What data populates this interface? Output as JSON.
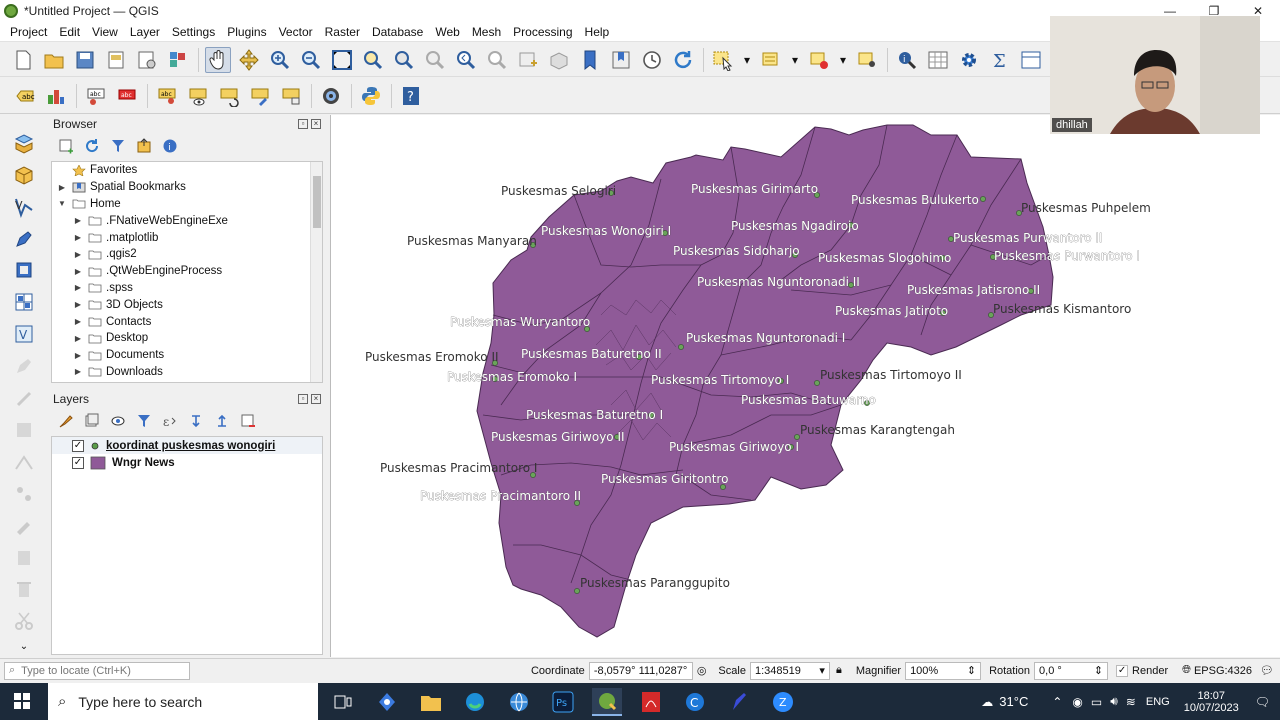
{
  "window": {
    "title": "*Untitled Project — QGIS",
    "min_icon": "minimize-icon",
    "max_icon": "maximize-icon",
    "close_icon": "close-icon"
  },
  "menu": [
    "Project",
    "Edit",
    "View",
    "Layer",
    "Settings",
    "Plugins",
    "Vector",
    "Raster",
    "Database",
    "Web",
    "Mesh",
    "Processing",
    "Help"
  ],
  "browser": {
    "title": "Browser",
    "items": [
      {
        "label": "Favorites",
        "icon": "star-icon",
        "level": 0,
        "arrow": ""
      },
      {
        "label": "Spatial Bookmarks",
        "icon": "bookmark-icon",
        "level": 0,
        "arrow": "▶"
      },
      {
        "label": "Home",
        "icon": "folder-icon",
        "level": 0,
        "arrow": "▼"
      },
      {
        "label": ".FNativeWebEngineExe",
        "icon": "folder-icon",
        "level": 1,
        "arrow": "▶"
      },
      {
        "label": ".matplotlib",
        "icon": "folder-icon",
        "level": 1,
        "arrow": "▶"
      },
      {
        "label": ".qgis2",
        "icon": "folder-icon",
        "level": 1,
        "arrow": "▶"
      },
      {
        "label": ".QtWebEngineProcess",
        "icon": "folder-icon",
        "level": 1,
        "arrow": "▶"
      },
      {
        "label": ".spss",
        "icon": "folder-icon",
        "level": 1,
        "arrow": "▶"
      },
      {
        "label": "3D Objects",
        "icon": "folder-icon",
        "level": 1,
        "arrow": "▶"
      },
      {
        "label": "Contacts",
        "icon": "folder-icon",
        "level": 1,
        "arrow": "▶"
      },
      {
        "label": "Desktop",
        "icon": "folder-icon",
        "level": 1,
        "arrow": "▶"
      },
      {
        "label": "Documents",
        "icon": "folder-icon",
        "level": 1,
        "arrow": "▶"
      },
      {
        "label": "Downloads",
        "icon": "folder-icon",
        "level": 1,
        "arrow": "▶"
      }
    ]
  },
  "layers": {
    "title": "Layers",
    "items": [
      {
        "label": "koordinat puskesmas wonogiri",
        "checked": "✓",
        "type": "point",
        "underline": true
      },
      {
        "label": "Wngr News",
        "checked": "✓",
        "type": "polygon",
        "color": "#8f5a98"
      }
    ]
  },
  "map": {
    "fill_color": "#8f5a98",
    "labels": [
      {
        "text": "Puskesmas Selogiri",
        "inside": false
      },
      {
        "text": "Puskesmas Girimarto",
        "inside": true
      },
      {
        "text": "Puskesmas Bulukerto",
        "inside": true
      },
      {
        "text": "Puskesmas Puhpelem",
        "inside": false
      },
      {
        "text": "Puskesmas Wonogiri I",
        "inside": true
      },
      {
        "text": "Puskesmas Ngadirojo",
        "inside": true
      },
      {
        "text": "Puskesmas Manyaran",
        "inside": false
      },
      {
        "text": "Puskesmas Purwantoro II",
        "inside": true
      },
      {
        "text": "Puskesmas Sidoharjo",
        "inside": true
      },
      {
        "text": "Puskesmas Slogohimo",
        "inside": true
      },
      {
        "text": "Puskesmas Purwantoro I",
        "inside": true
      },
      {
        "text": "Puskesmas Nguntoronadi II",
        "inside": true
      },
      {
        "text": "Puskesmas Jatisrono II",
        "inside": true
      },
      {
        "text": "Puskesmas Jatiroto",
        "inside": true
      },
      {
        "text": "Puskesmas Kismantoro",
        "inside": false
      },
      {
        "text": "Puskesmas Wuryantoro",
        "inside": true
      },
      {
        "text": "Puskesmas Nguntoronadi I",
        "inside": true
      },
      {
        "text": "Puskesmas Eromoko II",
        "inside": false
      },
      {
        "text": "Puskesmas Baturetno II",
        "inside": true
      },
      {
        "text": "Puskesmas Eromoko I",
        "inside": true
      },
      {
        "text": "Puskesmas Tirtomoyo I",
        "inside": true
      },
      {
        "text": "Puskesmas Tirtomoyo II",
        "inside": false
      },
      {
        "text": "Puskesmas Batuwarno",
        "inside": true
      },
      {
        "text": "Puskesmas Baturetno I",
        "inside": true
      },
      {
        "text": "Puskesmas Karangtengah",
        "inside": false
      },
      {
        "text": "Puskesmas Giriwoyo II",
        "inside": true
      },
      {
        "text": "Puskesmas Giriwoyo I",
        "inside": true
      },
      {
        "text": "Puskesmas Pracimantoro I",
        "inside": false
      },
      {
        "text": "Puskesmas Giritontro",
        "inside": true
      },
      {
        "text": "Puskesmas Pracimantoro II",
        "inside": true
      },
      {
        "text": "Puskesmas Paranggupito",
        "inside": false
      }
    ]
  },
  "webcam": {
    "name": "dhillah"
  },
  "status": {
    "locator_placeholder": "Type to locate (Ctrl+K)",
    "coordinate_label": "Coordinate",
    "coordinate_value": "-8,0579° 111,0287°",
    "scale_label": "Scale",
    "scale_value": "1:348519",
    "magnifier_label": "Magnifier",
    "magnifier_value": "100%",
    "rotation_label": "Rotation",
    "rotation_value": "0,0 °",
    "render_label": "Render",
    "epsg": "EPSG:4326"
  },
  "taskbar": {
    "search_placeholder": "Type here to search",
    "weather": "31°C",
    "lang": "ENG",
    "time": "18:07",
    "date": "10/07/2023"
  }
}
